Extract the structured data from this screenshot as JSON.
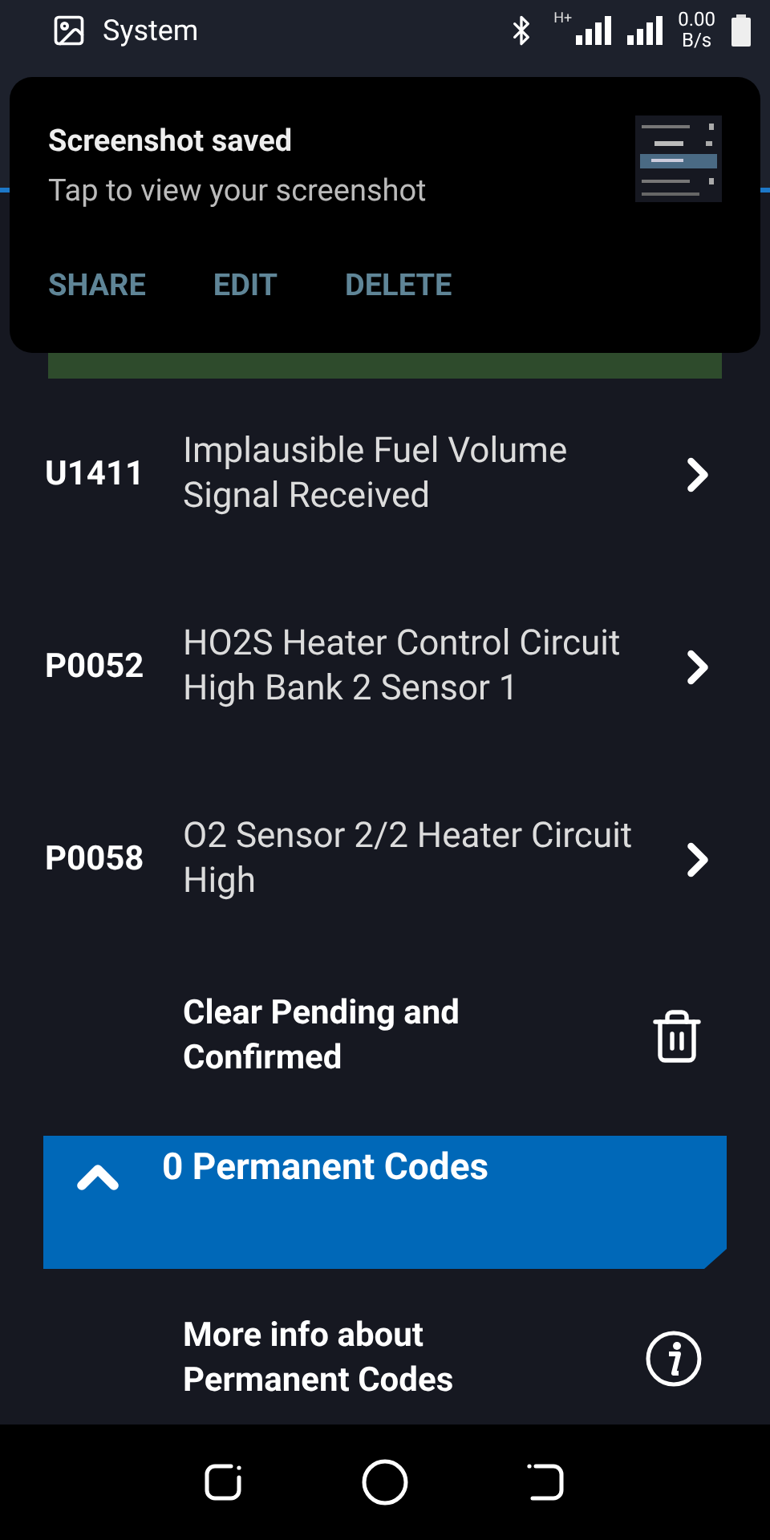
{
  "status_bar": {
    "app": "System",
    "network": "H+",
    "speed": "0.00",
    "speed_unit": "B/s"
  },
  "notification": {
    "title": "Screenshot saved",
    "text": "Tap to view your screenshot",
    "actions": [
      "SHARE",
      "EDIT",
      "DELETE"
    ]
  },
  "codes": [
    {
      "code": "U1411",
      "description": "Implausible Fuel Volume Signal Received"
    },
    {
      "code": "P0052",
      "description": "HO2S Heater Control Circuit High Bank 2 Sensor 1"
    },
    {
      "code": "P0058",
      "description": "O2 Sensor 2/2 Heater Circuit High"
    }
  ],
  "clear_action": "Clear Pending and Confirmed",
  "permanent_section": {
    "title": "0 Permanent Codes",
    "expanded": true
  },
  "more_info": "More info about Permanent Codes"
}
